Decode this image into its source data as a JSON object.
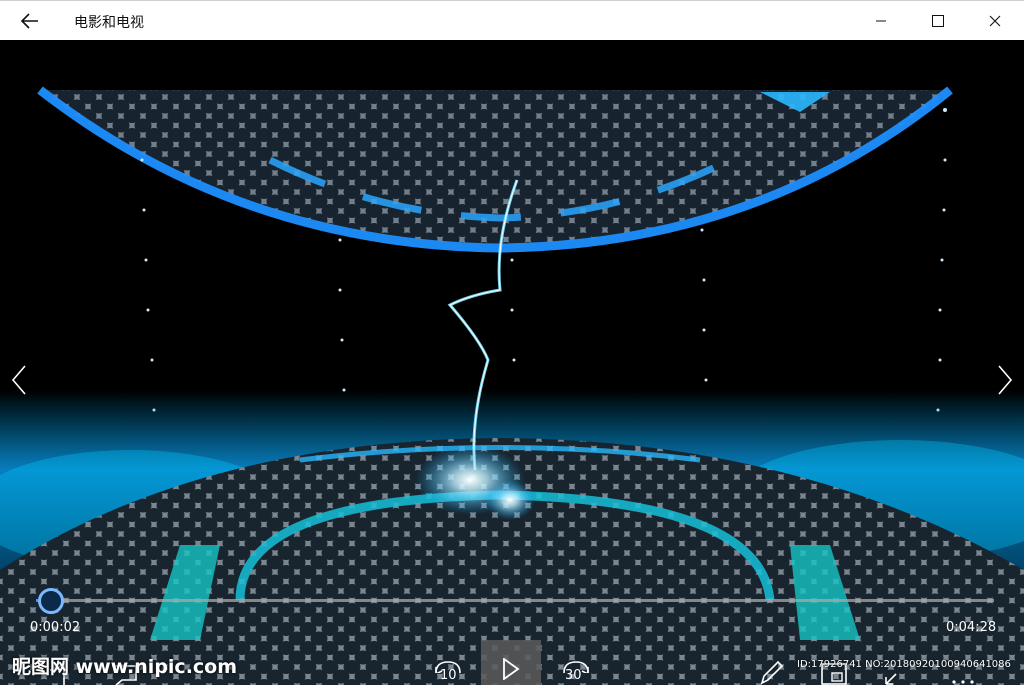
{
  "window": {
    "title": "电影和电视",
    "back_icon": "back-arrow-icon",
    "minimize_icon": "minimize-icon",
    "maximize_icon": "maximize-icon",
    "close_icon": "close-icon"
  },
  "player": {
    "current_time": "0:00:02",
    "total_time": "0:04:28",
    "progress": 0.0075,
    "skip_back_label": "10",
    "skip_forward_label": "30",
    "accent_color": "#4a90e2"
  },
  "watermark": {
    "logo": "昵图网 www.nipic.com",
    "id_text": "ID:17926741 NO:20180920100940641086"
  }
}
